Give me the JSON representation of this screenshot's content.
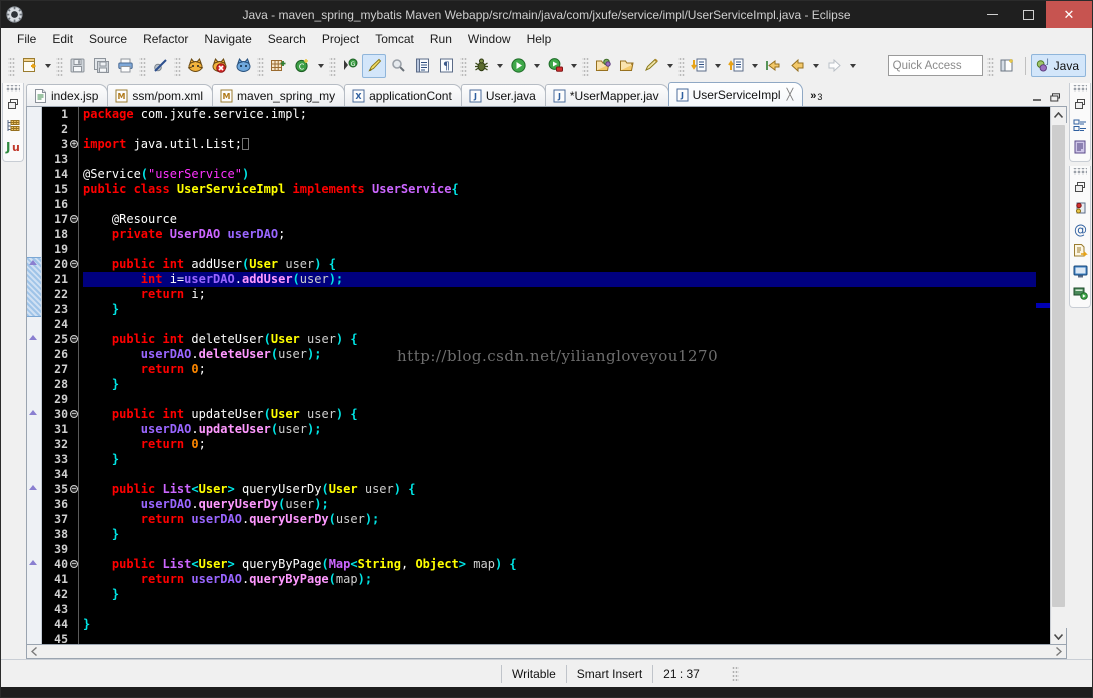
{
  "window": {
    "title": "Java - maven_spring_mybatis Maven Webapp/src/main/java/com/jxufe/service/impl/UserServiceImpl.java - Eclipse",
    "logo_icon": "eclipse-logo-icon",
    "minimize_label": "Minimize",
    "maximize_label": "Maximize",
    "close_label": "Close"
  },
  "menubar": {
    "items": [
      {
        "label": "File"
      },
      {
        "label": "Edit"
      },
      {
        "label": "Source"
      },
      {
        "label": "Refactor"
      },
      {
        "label": "Navigate"
      },
      {
        "label": "Search"
      },
      {
        "label": "Project"
      },
      {
        "label": "Tomcat"
      },
      {
        "label": "Run"
      },
      {
        "label": "Window"
      },
      {
        "label": "Help"
      }
    ]
  },
  "toolbar": {
    "quick_access_placeholder": "Quick Access",
    "perspective_java_label": "Java",
    "open_perspective_icon": "open-perspective-icon",
    "buttons": [
      {
        "icon": "new-wizard-icon",
        "label": "New"
      },
      {
        "icon": "save-icon",
        "label": "Save"
      },
      {
        "icon": "save-all-icon",
        "label": "Save All"
      },
      {
        "icon": "print-icon",
        "label": "Print"
      },
      {
        "icon": "skip-breakpoints-icon",
        "label": "Skip All Breakpoints"
      },
      {
        "icon": "tomcat-start-icon",
        "label": "Start Tomcat"
      },
      {
        "icon": "tomcat-stop-icon",
        "label": "Stop Tomcat"
      },
      {
        "icon": "tomcat-restart-icon",
        "label": "Restart Tomcat"
      },
      {
        "icon": "new-java-package-icon",
        "label": "New Java Package"
      },
      {
        "icon": "new-java-class-icon",
        "label": "New Java Class"
      },
      {
        "icon": "externalize-strings-icon",
        "label": "Externalize Strings"
      },
      {
        "icon": "toggle-markoccurrences-icon",
        "label": "Toggle Mark Occurrences"
      },
      {
        "icon": "search-icon",
        "label": "Search"
      },
      {
        "icon": "open-task-icon",
        "label": "Open Task"
      },
      {
        "icon": "show-whitespace-icon",
        "label": "Show Whitespace Characters"
      },
      {
        "icon": "debug-icon",
        "label": "Debug"
      },
      {
        "icon": "run-icon",
        "label": "Run"
      },
      {
        "icon": "run-external-tools-icon",
        "label": "External Tools"
      },
      {
        "icon": "open-type-icon",
        "label": "Open Type"
      },
      {
        "icon": "open-task-folder-icon",
        "label": "Open Task"
      },
      {
        "icon": "new-annotation-icon",
        "label": "New Annotation"
      },
      {
        "icon": "next-annotation-icon",
        "label": "Next Annotation"
      },
      {
        "icon": "previous-annotation-icon",
        "label": "Previous Annotation"
      },
      {
        "icon": "last-edit-location-icon",
        "label": "Last Edit Location"
      },
      {
        "icon": "back-icon",
        "label": "Back"
      },
      {
        "icon": "forward-icon",
        "label": "Forward"
      }
    ]
  },
  "left_fastview": {
    "restore_icon": "restore-icon",
    "items": [
      {
        "icon": "package-explorer-icon",
        "label": "Package Explorer"
      },
      {
        "icon": "junit-icon",
        "label": "JUnit"
      }
    ]
  },
  "right_fastview": {
    "groups": [
      {
        "restore_icon": "restore-icon",
        "items": [
          {
            "icon": "outline-icon",
            "label": "Outline"
          },
          {
            "icon": "task-list-icon",
            "label": "Task List"
          }
        ]
      },
      {
        "restore_icon": "restore-icon",
        "items": [
          {
            "icon": "breakpoints-icon",
            "label": "Breakpoints"
          },
          {
            "icon": "at-sign-icon",
            "label": "Javadoc"
          },
          {
            "icon": "declaration-icon",
            "label": "Declaration"
          },
          {
            "icon": "console-icon",
            "label": "Console"
          },
          {
            "icon": "servers-icon",
            "label": "Servers"
          }
        ]
      }
    ]
  },
  "editor_tabs": {
    "overflow_label": "»",
    "overflow_count": "3",
    "minimize_label": "Minimize",
    "maximize_label": "Maximize",
    "items": [
      {
        "label": "index.jsp",
        "icon": "jsp-file-icon",
        "active": false,
        "dirty": false
      },
      {
        "label": "ssm/pom.xml",
        "icon": "maven-file-icon",
        "active": false,
        "dirty": false
      },
      {
        "label": "maven_spring_my",
        "icon": "maven-file-icon",
        "active": false,
        "dirty": false
      },
      {
        "label": "applicationCont",
        "icon": "xml-file-icon",
        "active": false,
        "dirty": false
      },
      {
        "label": "User.java",
        "icon": "java-file-icon",
        "active": false,
        "dirty": false
      },
      {
        "label": "*UserMapper.jav",
        "icon": "java-file-icon",
        "active": false,
        "dirty": true
      },
      {
        "label": "UserServiceImpl",
        "icon": "java-file-icon",
        "active": true,
        "dirty": false
      }
    ]
  },
  "editor": {
    "watermark": "http://blog.csdn.net/yiliangloveyou1270",
    "highlighted_line": 21,
    "first_line_number": 1,
    "lines": [
      {
        "n": "1",
        "fold": "none",
        "tokens": [
          {
            "t": "package ",
            "c": "tk-key"
          },
          {
            "t": "com.jxufe.service.impl;",
            "c": "tk-plain"
          }
        ]
      },
      {
        "n": "2",
        "fold": "none",
        "tokens": []
      },
      {
        "n": "3",
        "fold": "collapsed",
        "tokens": [
          {
            "t": "import ",
            "c": "tk-key"
          },
          {
            "t": "java.util.List;",
            "c": "tk-plain"
          },
          {
            "t": "░",
            "c": "tk-caret"
          }
        ]
      },
      {
        "n": "13",
        "fold": "none",
        "tokens": []
      },
      {
        "n": "14",
        "fold": "none",
        "tokens": [
          {
            "t": "@Service",
            "c": "tk-plain"
          },
          {
            "t": "(",
            "c": "tk-punc"
          },
          {
            "t": "\"userService\"",
            "c": "tk-str"
          },
          {
            "t": ")",
            "c": "tk-punc"
          }
        ]
      },
      {
        "n": "15",
        "fold": "none",
        "tokens": [
          {
            "t": "public class ",
            "c": "tk-key"
          },
          {
            "t": "UserServiceImpl",
            "c": "tk-cls"
          },
          {
            "t": " ",
            "c": "tk-plain"
          },
          {
            "t": "implements ",
            "c": "tk-key"
          },
          {
            "t": "UserService",
            "c": "tk-type"
          },
          {
            "t": "{",
            "c": "tk-punc"
          }
        ]
      },
      {
        "n": "16",
        "fold": "none",
        "tokens": []
      },
      {
        "n": "17",
        "fold": "expanded",
        "tokens": [
          {
            "t": "    @Resource",
            "c": "tk-plain"
          }
        ]
      },
      {
        "n": "18",
        "fold": "none",
        "tokens": [
          {
            "t": "    ",
            "c": "tk-plain"
          },
          {
            "t": "private ",
            "c": "tk-key"
          },
          {
            "t": "UserDAO",
            "c": "tk-type"
          },
          {
            "t": " ",
            "c": "tk-plain"
          },
          {
            "t": "userDAO",
            "c": "tk-fld"
          },
          {
            "t": ";",
            "c": "tk-plain"
          }
        ]
      },
      {
        "n": "19",
        "fold": "none",
        "tokens": []
      },
      {
        "n": "20",
        "fold": "expanded",
        "tokens": [
          {
            "t": "    ",
            "c": "tk-plain"
          },
          {
            "t": "public int ",
            "c": "tk-key"
          },
          {
            "t": "addUser",
            "c": "tk-plain"
          },
          {
            "t": "(",
            "c": "tk-punc"
          },
          {
            "t": "User",
            "c": "tk-cls"
          },
          {
            "t": " ",
            "c": "tk-plain"
          },
          {
            "t": "user",
            "c": "tk-var"
          },
          {
            "t": ") {",
            "c": "tk-punc"
          }
        ]
      },
      {
        "n": "21",
        "fold": "none",
        "tokens": [
          {
            "t": "        ",
            "c": "tk-plain"
          },
          {
            "t": "int ",
            "c": "tk-key"
          },
          {
            "t": "i=",
            "c": "tk-plain"
          },
          {
            "t": "userDAO",
            "c": "tk-fld"
          },
          {
            "t": ".",
            "c": "tk-plain"
          },
          {
            "t": "addUser",
            "c": "tk-mth"
          },
          {
            "t": "(",
            "c": "tk-punc"
          },
          {
            "t": "user",
            "c": "tk-var"
          },
          {
            "t": ");",
            "c": "tk-punc"
          }
        ]
      },
      {
        "n": "22",
        "fold": "none",
        "tokens": [
          {
            "t": "        ",
            "c": "tk-plain"
          },
          {
            "t": "return ",
            "c": "tk-key"
          },
          {
            "t": "i;",
            "c": "tk-plain"
          }
        ]
      },
      {
        "n": "23",
        "fold": "none",
        "tokens": [
          {
            "t": "    }",
            "c": "tk-punc"
          }
        ]
      },
      {
        "n": "24",
        "fold": "none",
        "tokens": []
      },
      {
        "n": "25",
        "fold": "expanded",
        "tokens": [
          {
            "t": "    ",
            "c": "tk-plain"
          },
          {
            "t": "public int ",
            "c": "tk-key"
          },
          {
            "t": "deleteUser",
            "c": "tk-plain"
          },
          {
            "t": "(",
            "c": "tk-punc"
          },
          {
            "t": "User",
            "c": "tk-cls"
          },
          {
            "t": " ",
            "c": "tk-plain"
          },
          {
            "t": "user",
            "c": "tk-var"
          },
          {
            "t": ") {",
            "c": "tk-punc"
          }
        ]
      },
      {
        "n": "26",
        "fold": "none",
        "tokens": [
          {
            "t": "        ",
            "c": "tk-plain"
          },
          {
            "t": "userDAO",
            "c": "tk-fld"
          },
          {
            "t": ".",
            "c": "tk-plain"
          },
          {
            "t": "deleteUser",
            "c": "tk-mth"
          },
          {
            "t": "(",
            "c": "tk-punc"
          },
          {
            "t": "user",
            "c": "tk-var"
          },
          {
            "t": ");",
            "c": "tk-punc"
          }
        ]
      },
      {
        "n": "27",
        "fold": "none",
        "tokens": [
          {
            "t": "        ",
            "c": "tk-plain"
          },
          {
            "t": "return ",
            "c": "tk-key"
          },
          {
            "t": "0",
            "c": "tk-num"
          },
          {
            "t": ";",
            "c": "tk-plain"
          }
        ]
      },
      {
        "n": "28",
        "fold": "none",
        "tokens": [
          {
            "t": "    }",
            "c": "tk-punc"
          }
        ]
      },
      {
        "n": "29",
        "fold": "none",
        "tokens": []
      },
      {
        "n": "30",
        "fold": "expanded",
        "tokens": [
          {
            "t": "    ",
            "c": "tk-plain"
          },
          {
            "t": "public int ",
            "c": "tk-key"
          },
          {
            "t": "updateUser",
            "c": "tk-plain"
          },
          {
            "t": "(",
            "c": "tk-punc"
          },
          {
            "t": "User",
            "c": "tk-cls"
          },
          {
            "t": " ",
            "c": "tk-plain"
          },
          {
            "t": "user",
            "c": "tk-var"
          },
          {
            "t": ") {",
            "c": "tk-punc"
          }
        ]
      },
      {
        "n": "31",
        "fold": "none",
        "tokens": [
          {
            "t": "        ",
            "c": "tk-plain"
          },
          {
            "t": "userDAO",
            "c": "tk-fld"
          },
          {
            "t": ".",
            "c": "tk-plain"
          },
          {
            "t": "updateUser",
            "c": "tk-mth"
          },
          {
            "t": "(",
            "c": "tk-punc"
          },
          {
            "t": "user",
            "c": "tk-var"
          },
          {
            "t": ");",
            "c": "tk-punc"
          }
        ]
      },
      {
        "n": "32",
        "fold": "none",
        "tokens": [
          {
            "t": "        ",
            "c": "tk-plain"
          },
          {
            "t": "return ",
            "c": "tk-key"
          },
          {
            "t": "0",
            "c": "tk-num"
          },
          {
            "t": ";",
            "c": "tk-plain"
          }
        ]
      },
      {
        "n": "33",
        "fold": "none",
        "tokens": [
          {
            "t": "    }",
            "c": "tk-punc"
          }
        ]
      },
      {
        "n": "34",
        "fold": "none",
        "tokens": []
      },
      {
        "n": "35",
        "fold": "expanded",
        "tokens": [
          {
            "t": "    ",
            "c": "tk-plain"
          },
          {
            "t": "public ",
            "c": "tk-key"
          },
          {
            "t": "List",
            "c": "tk-type"
          },
          {
            "t": "<",
            "c": "tk-punc"
          },
          {
            "t": "User",
            "c": "tk-cls"
          },
          {
            "t": "> ",
            "c": "tk-punc"
          },
          {
            "t": "queryUserDy",
            "c": "tk-plain"
          },
          {
            "t": "(",
            "c": "tk-punc"
          },
          {
            "t": "User",
            "c": "tk-cls"
          },
          {
            "t": " ",
            "c": "tk-plain"
          },
          {
            "t": "user",
            "c": "tk-var"
          },
          {
            "t": ") {",
            "c": "tk-punc"
          }
        ]
      },
      {
        "n": "36",
        "fold": "none",
        "tokens": [
          {
            "t": "        ",
            "c": "tk-plain"
          },
          {
            "t": "userDAO",
            "c": "tk-fld"
          },
          {
            "t": ".",
            "c": "tk-plain"
          },
          {
            "t": "queryUserDy",
            "c": "tk-mth"
          },
          {
            "t": "(",
            "c": "tk-punc"
          },
          {
            "t": "user",
            "c": "tk-var"
          },
          {
            "t": ");",
            "c": "tk-punc"
          }
        ]
      },
      {
        "n": "37",
        "fold": "none",
        "tokens": [
          {
            "t": "        ",
            "c": "tk-plain"
          },
          {
            "t": "return ",
            "c": "tk-key"
          },
          {
            "t": "userDAO",
            "c": "tk-fld"
          },
          {
            "t": ".",
            "c": "tk-plain"
          },
          {
            "t": "queryUserDy",
            "c": "tk-mth"
          },
          {
            "t": "(",
            "c": "tk-punc"
          },
          {
            "t": "user",
            "c": "tk-var"
          },
          {
            "t": ");",
            "c": "tk-punc"
          }
        ]
      },
      {
        "n": "38",
        "fold": "none",
        "tokens": [
          {
            "t": "    }",
            "c": "tk-punc"
          }
        ]
      },
      {
        "n": "39",
        "fold": "none",
        "tokens": []
      },
      {
        "n": "40",
        "fold": "expanded",
        "tokens": [
          {
            "t": "    ",
            "c": "tk-plain"
          },
          {
            "t": "public ",
            "c": "tk-key"
          },
          {
            "t": "List",
            "c": "tk-type"
          },
          {
            "t": "<",
            "c": "tk-punc"
          },
          {
            "t": "User",
            "c": "tk-cls"
          },
          {
            "t": "> ",
            "c": "tk-punc"
          },
          {
            "t": "queryByPage",
            "c": "tk-plain"
          },
          {
            "t": "(",
            "c": "tk-punc"
          },
          {
            "t": "Map",
            "c": "tk-type"
          },
          {
            "t": "<",
            "c": "tk-punc"
          },
          {
            "t": "String",
            "c": "tk-cls"
          },
          {
            "t": ", ",
            "c": "tk-plain"
          },
          {
            "t": "Object",
            "c": "tk-cls"
          },
          {
            "t": "> ",
            "c": "tk-punc"
          },
          {
            "t": "map",
            "c": "tk-var"
          },
          {
            "t": ") {",
            "c": "tk-punc"
          }
        ]
      },
      {
        "n": "41",
        "fold": "none",
        "tokens": [
          {
            "t": "        ",
            "c": "tk-plain"
          },
          {
            "t": "return ",
            "c": "tk-key"
          },
          {
            "t": "userDAO",
            "c": "tk-fld"
          },
          {
            "t": ".",
            "c": "tk-plain"
          },
          {
            "t": "queryByPage",
            "c": "tk-mth"
          },
          {
            "t": "(",
            "c": "tk-punc"
          },
          {
            "t": "map",
            "c": "tk-var"
          },
          {
            "t": ");",
            "c": "tk-punc"
          }
        ]
      },
      {
        "n": "42",
        "fold": "none",
        "tokens": [
          {
            "t": "    }",
            "c": "tk-punc"
          }
        ]
      },
      {
        "n": "43",
        "fold": "none",
        "tokens": []
      },
      {
        "n": "44",
        "fold": "none",
        "tokens": [
          {
            "t": "}",
            "c": "tk-punc"
          }
        ]
      },
      {
        "n": "45",
        "fold": "none",
        "tokens": []
      }
    ]
  },
  "statusbar": {
    "writable": "Writable",
    "insert_mode": "Smart Insert",
    "cursor_position": "21 : 37"
  },
  "colors": {
    "titlebar_bg": "#1f1f1f",
    "close_button": "#c75450",
    "chrome_bg": "#f0f0f0",
    "editor_bg": "#000000",
    "selection_bg": "#00007f",
    "keyword": "#ff0000",
    "class_name": "#ffff00",
    "type_name": "#cc66ff",
    "punctuation": "#00e5e5",
    "string": "#ff33ff",
    "field": "#9966ff",
    "method": "#ff99ff",
    "number": "#ff8800",
    "watermark": "#6e6e6e"
  }
}
